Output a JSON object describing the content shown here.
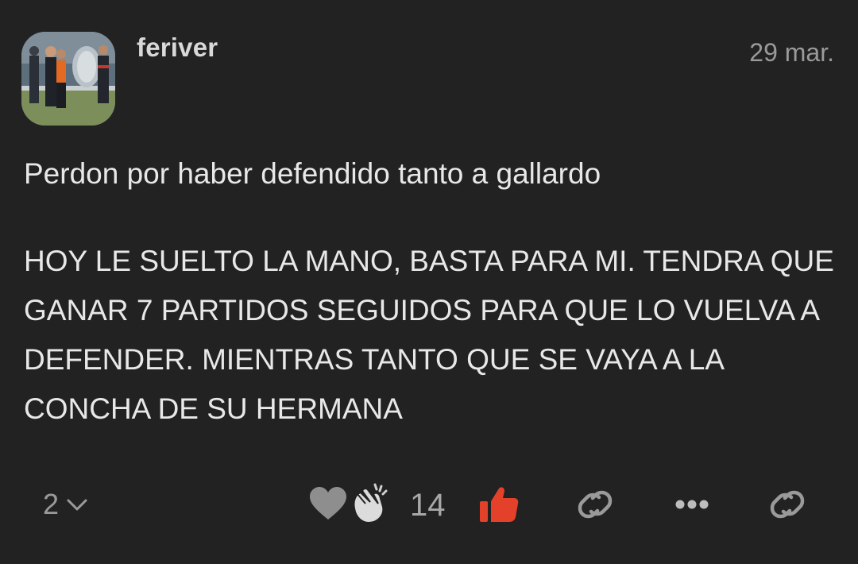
{
  "post": {
    "username": "feriver",
    "timestamp": "29 mar.",
    "paragraphs": [
      "Perdon por haber defendido tanto a gallardo",
      "HOY LE SUELTO LA MANO, BASTA PARA MI. TENDRA QUE GANAR 7 PARTIDOS SEGUIDOS PARA QUE LO VUELVA A DEFENDER. MIENTRAS TANTO QUE SE VAYA A LA CONCHA DE SU HERMANA"
    ]
  },
  "footer": {
    "reply_count": "2",
    "reaction_count": "14",
    "icons": {
      "replies_toggle": "chevron-down-icon",
      "heart": "heart-icon",
      "clap": "clap-icon",
      "like": "thumbs-up-icon",
      "copy_link": "link-icon",
      "more": "more-icon",
      "share_link": "link-icon"
    }
  },
  "colors": {
    "background": "#222222",
    "text": "#e8e8e8",
    "muted": "#9a9a9a",
    "like_accent": "#e4412b"
  }
}
